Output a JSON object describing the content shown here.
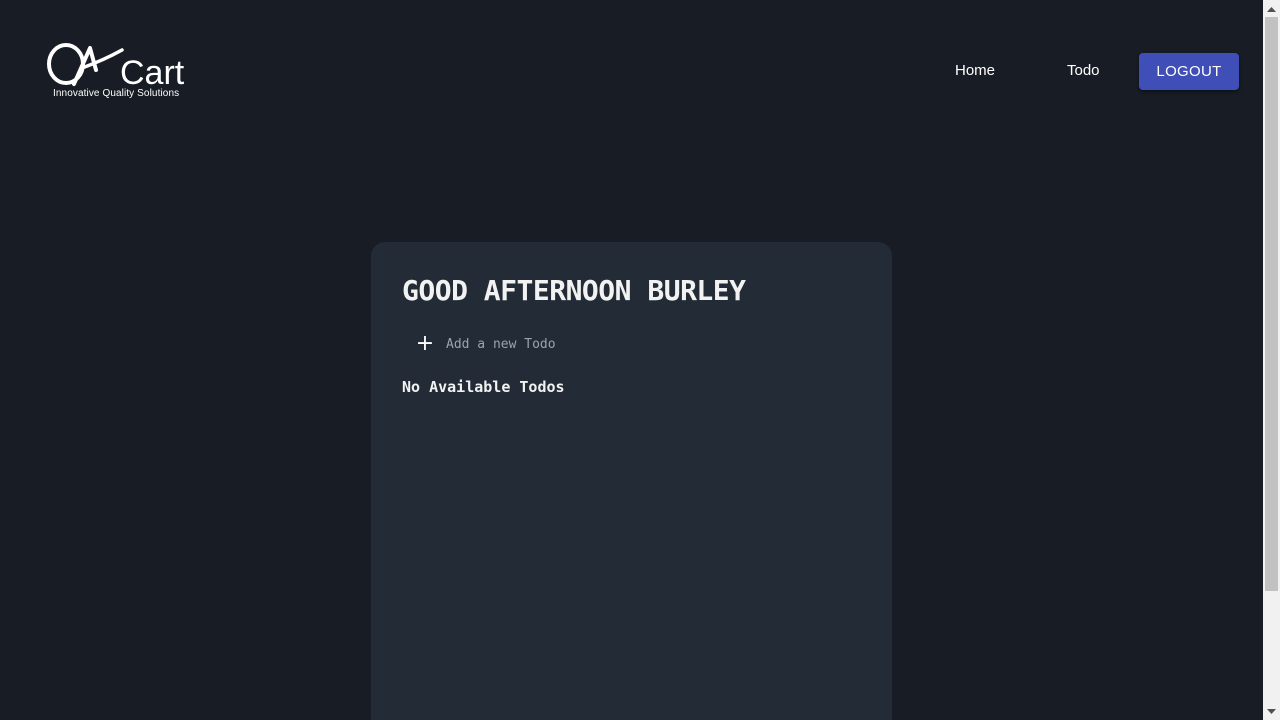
{
  "header": {
    "logo_text": "QACart",
    "logo_tagline": "Innovative Quality Solutions",
    "nav": {
      "home_label": "Home",
      "todo_label": "Todo"
    },
    "logout_label": "LOGOUT"
  },
  "main": {
    "greeting": "GOOD AFTERNOON BURLEY",
    "add_todo": {
      "icon": "plus-icon",
      "placeholder": "Add a new Todo",
      "value": ""
    },
    "empty_message": "No Available Todos"
  },
  "colors": {
    "background": "#171c25",
    "card": "#222b36",
    "logout_button": "#3f4fb7",
    "scrollbar_track": "#f1f1f1",
    "scrollbar_thumb": "#c1c1c1"
  }
}
